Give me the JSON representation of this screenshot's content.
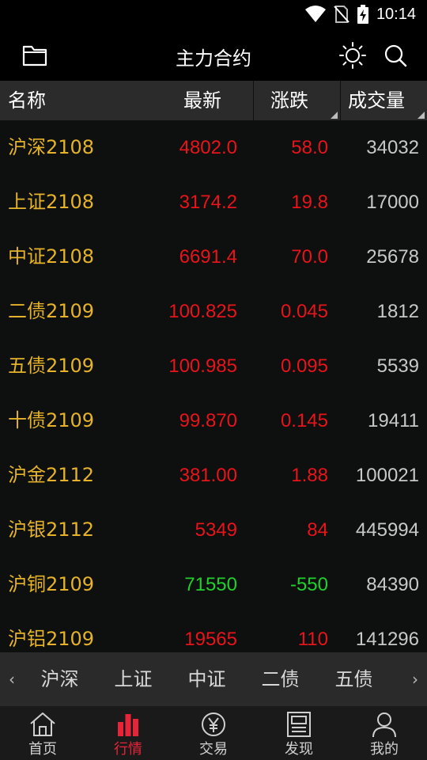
{
  "status_bar": {
    "time": "10:14"
  },
  "header": {
    "title": "主力合约"
  },
  "columns": {
    "name": "名称",
    "last": "最新",
    "change": "涨跌",
    "volume": "成交量"
  },
  "rows": [
    {
      "name": "沪深2108",
      "last": "4802.0",
      "change": "58.0",
      "volume": "34032",
      "trend": "up"
    },
    {
      "name": "上证2108",
      "last": "3174.2",
      "change": "19.8",
      "volume": "17000",
      "trend": "up"
    },
    {
      "name": "中证2108",
      "last": "6691.4",
      "change": "70.0",
      "volume": "25678",
      "trend": "up"
    },
    {
      "name": "二债2109",
      "last": "100.825",
      "change": "0.045",
      "volume": "1812",
      "trend": "up"
    },
    {
      "name": "五债2109",
      "last": "100.985",
      "change": "0.095",
      "volume": "5539",
      "trend": "up"
    },
    {
      "name": "十债2109",
      "last": "99.870",
      "change": "0.145",
      "volume": "19411",
      "trend": "up"
    },
    {
      "name": "沪金2112",
      "last": "381.00",
      "change": "1.88",
      "volume": "100021",
      "trend": "up"
    },
    {
      "name": "沪银2112",
      "last": "5349",
      "change": "84",
      "volume": "445994",
      "trend": "up"
    },
    {
      "name": "沪铜2109",
      "last": "71550",
      "change": "-550",
      "volume": "84390",
      "trend": "down"
    },
    {
      "name": "沪铝2109",
      "last": "19565",
      "change": "110",
      "volume": "141296",
      "trend": "up"
    }
  ],
  "quick_tabs": [
    "沪深",
    "上证",
    "中证",
    "二债",
    "五债"
  ],
  "bottom_nav": [
    {
      "label": "首页",
      "icon": "home-icon",
      "active": false
    },
    {
      "label": "行情",
      "icon": "market-chart-icon",
      "active": true
    },
    {
      "label": "交易",
      "icon": "yen-circle-icon",
      "active": false
    },
    {
      "label": "发现",
      "icon": "news-icon",
      "active": false
    },
    {
      "label": "我的",
      "icon": "user-icon",
      "active": false
    }
  ],
  "colors": {
    "up": "#e8141a",
    "down": "#22d02b",
    "name": "#e5b22a",
    "active_tab": "#e8243b"
  }
}
